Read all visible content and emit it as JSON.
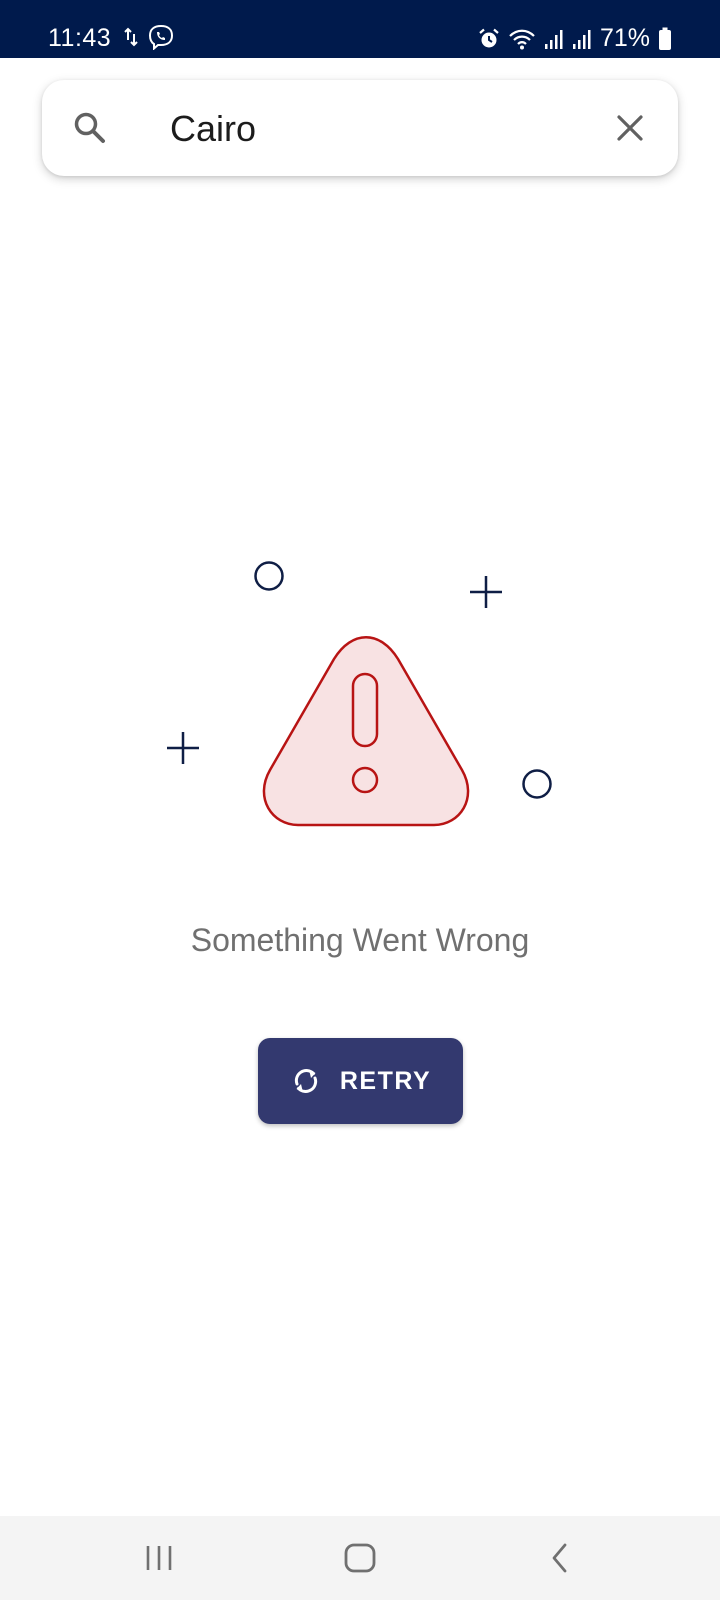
{
  "status_bar": {
    "time": "11:43",
    "battery_percent": "71%",
    "left_icons": [
      "data-transfer-icon",
      "viber-icon"
    ],
    "right_icons": [
      "alarm-icon",
      "wifi-icon",
      "signal-icon",
      "signal-icon",
      "battery-icon"
    ]
  },
  "search": {
    "value": "Cairo",
    "icon": "search-icon",
    "clear_icon": "close-icon"
  },
  "error": {
    "message": "Something Went Wrong",
    "illustration_icon": "warning-triangle-icon"
  },
  "retry_button": {
    "label": "RETRY",
    "icon": "refresh-icon"
  },
  "nav_bar": {
    "buttons": [
      "recent-apps-icon",
      "home-icon",
      "back-icon"
    ]
  },
  "colors": {
    "status_bar_bg": "#001a4c",
    "button_bg": "#33396f",
    "warning_stroke": "#b81414",
    "warning_fill": "#f8e2e3",
    "decoration": "#0f1e45",
    "message_text": "#707070"
  }
}
